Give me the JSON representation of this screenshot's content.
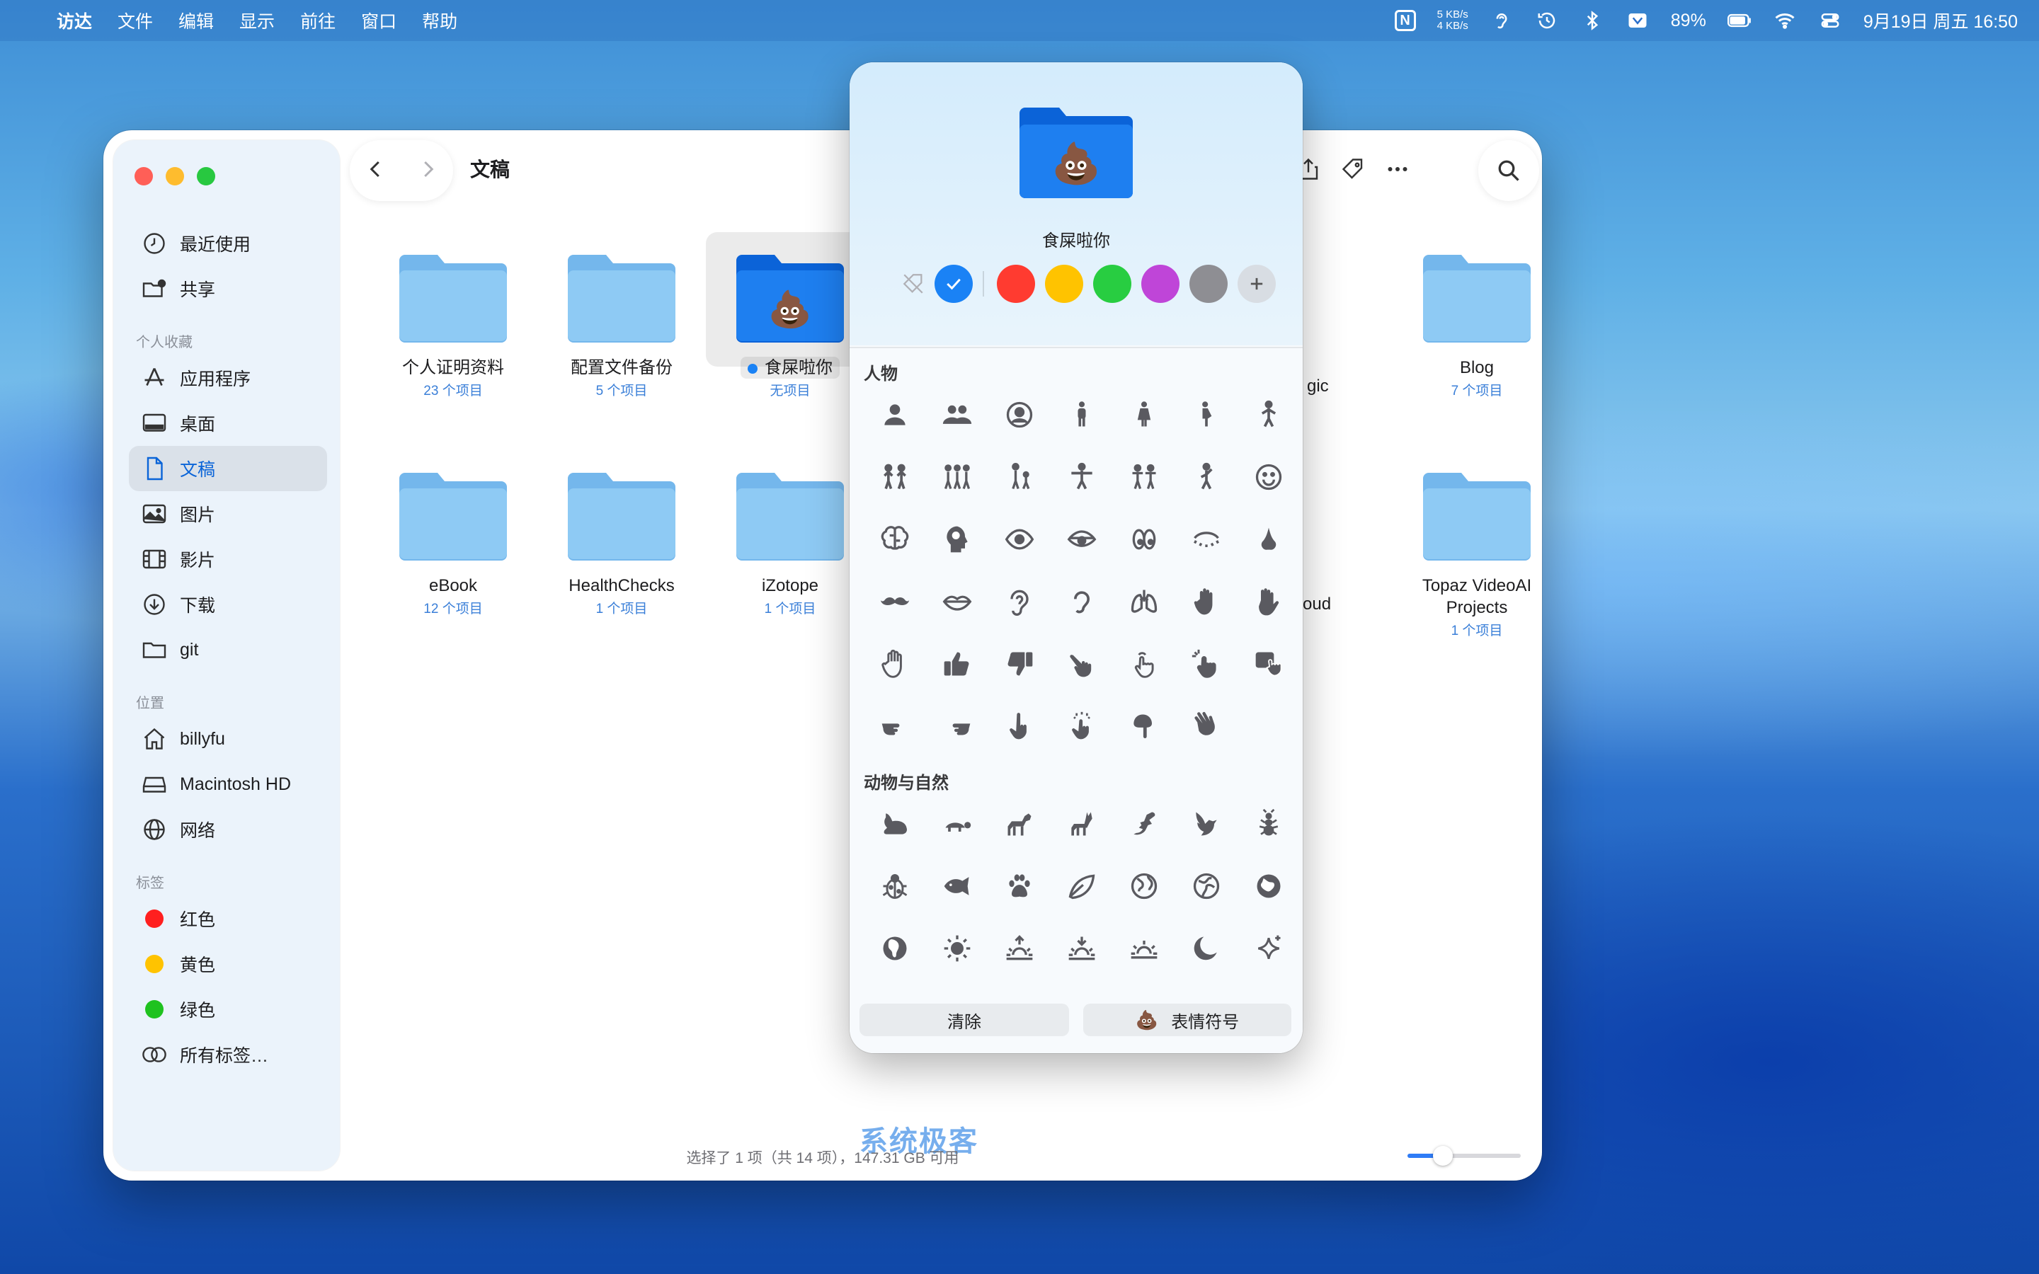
{
  "menubar": {
    "apple_glyph": "",
    "items": [
      "访达",
      "文件",
      "编辑",
      "显示",
      "前往",
      "窗口",
      "帮助"
    ],
    "net_up": "5 KB/s",
    "net_down": "4 KB/s",
    "battery": "89%",
    "datetime": "9月19日 周五  16:50",
    "n_badge": "N"
  },
  "window": {
    "title": "文稿",
    "status": "选择了 1 项（共 14 项），147.31 GB 可用"
  },
  "sidebar": {
    "top_items": [
      {
        "label": "最近使用",
        "icon": "clock-icon"
      },
      {
        "label": "共享",
        "icon": "shared-folder-icon"
      }
    ],
    "favorites_header": "个人收藏",
    "favorites": [
      {
        "label": "应用程序",
        "icon": "apps-icon"
      },
      {
        "label": "桌面",
        "icon": "desktop-icon"
      },
      {
        "label": "文稿",
        "icon": "document-icon"
      },
      {
        "label": "图片",
        "icon": "photo-icon"
      },
      {
        "label": "影片",
        "icon": "film-icon"
      },
      {
        "label": "下载",
        "icon": "download-icon"
      },
      {
        "label": "git",
        "icon": "folder-icon"
      }
    ],
    "locations_header": "位置",
    "locations": [
      {
        "label": "billyfu",
        "icon": "home-icon"
      },
      {
        "label": "Macintosh HD",
        "icon": "disk-icon"
      },
      {
        "label": "网络",
        "icon": "globe-icon"
      }
    ],
    "tags_header": "标签",
    "tags": [
      {
        "label": "红色",
        "color": "#ff3b30"
      },
      {
        "label": "黄色",
        "color": "#ffcc00"
      },
      {
        "label": "绿色",
        "color": "#28cd41"
      }
    ],
    "all_tags": "所有标签…"
  },
  "folders": [
    {
      "name": "个人证明资料",
      "count": "23 个项目"
    },
    {
      "name": "配置文件备份",
      "count": "5 个项目"
    },
    {
      "name": "食屎啦你",
      "count": "无项目",
      "emoji": "💩"
    },
    {
      "name": "gic",
      "count": ""
    },
    {
      "name": "Blog",
      "count": "7 个项目"
    },
    {
      "name": "eBook",
      "count": "12 个项目"
    },
    {
      "name": "HealthChecks",
      "count": "1 个项目"
    },
    {
      "name": "iZotope",
      "count": "1 个项目"
    },
    {
      "name": "oud",
      "count": ""
    },
    {
      "name": "Topaz VideoAI Projects",
      "count": "1 个项目"
    }
  ],
  "popover": {
    "folder_name": "食屎啦你",
    "emoji": "💩",
    "colors": [
      "#1a82f5",
      "#ff3b30",
      "#ffc300",
      "#28cd41",
      "#bf45d8",
      "#8e8e93"
    ],
    "people_title": "人物",
    "nature_title": "动物与自然",
    "clear_label": "清除",
    "emoji_label": "表情符号"
  },
  "watermark": "系统极客"
}
